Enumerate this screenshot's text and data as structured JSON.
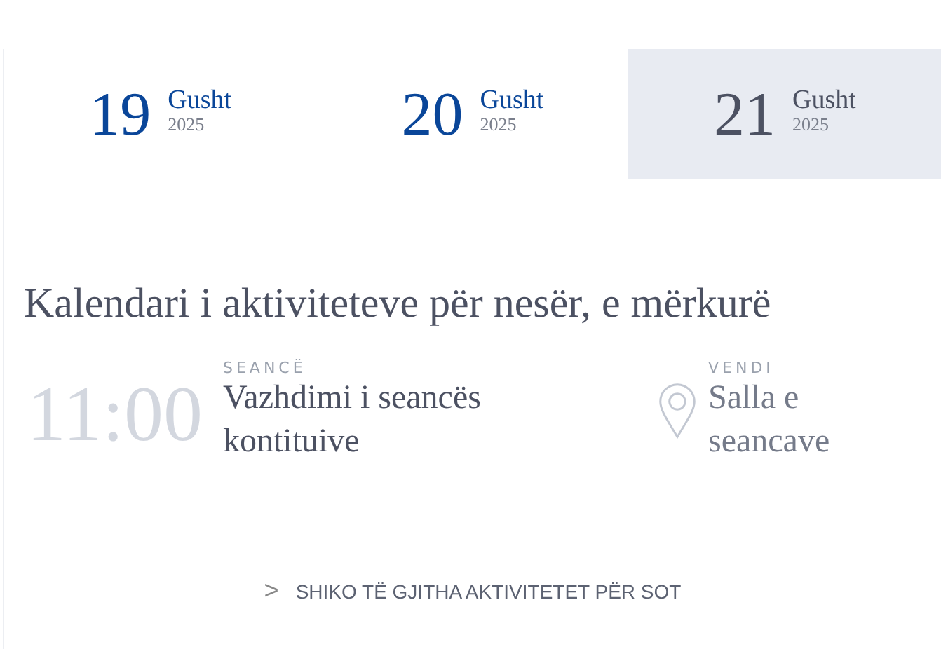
{
  "dates": [
    {
      "day": "19",
      "month": "Gusht",
      "year": "2025",
      "selected": false
    },
    {
      "day": "20",
      "month": "Gusht",
      "year": "2025",
      "selected": false
    },
    {
      "day": "21",
      "month": "Gusht",
      "year": "2025",
      "selected": true
    }
  ],
  "heading": "Kalendari i aktiviteteve për nesër, e mërkurë",
  "events": [
    {
      "time": "11:00",
      "session_label": "SEANCË",
      "session": "Vazhdimi i seancës kontituive",
      "venue_label": "VENDI",
      "venue": "Salla e seancave"
    }
  ],
  "link": {
    "icon": ">",
    "label": "SHIKO TË GJITHA AKTIVITETET PËR SOT"
  }
}
